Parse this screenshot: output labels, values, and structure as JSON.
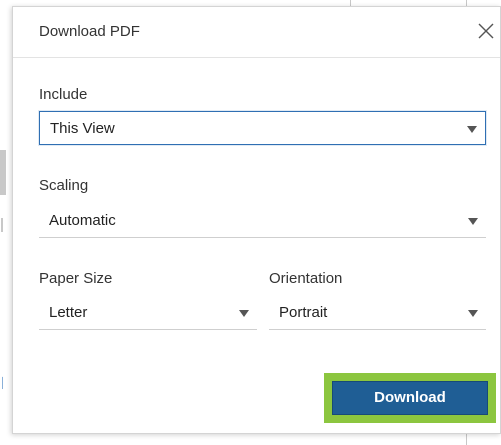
{
  "dialog": {
    "title": "Download PDF",
    "close_icon": "close-icon"
  },
  "include": {
    "label": "Include",
    "value": "This View"
  },
  "scaling": {
    "label": "Scaling",
    "value": "Automatic"
  },
  "paper_size": {
    "label": "Paper Size",
    "value": "Letter"
  },
  "orientation": {
    "label": "Orientation",
    "value": "Portrait"
  },
  "actions": {
    "download_label": "Download"
  },
  "colors": {
    "accent": "#1f5e95",
    "highlight": "#8cc63f",
    "focus": "#2f6fb3"
  }
}
